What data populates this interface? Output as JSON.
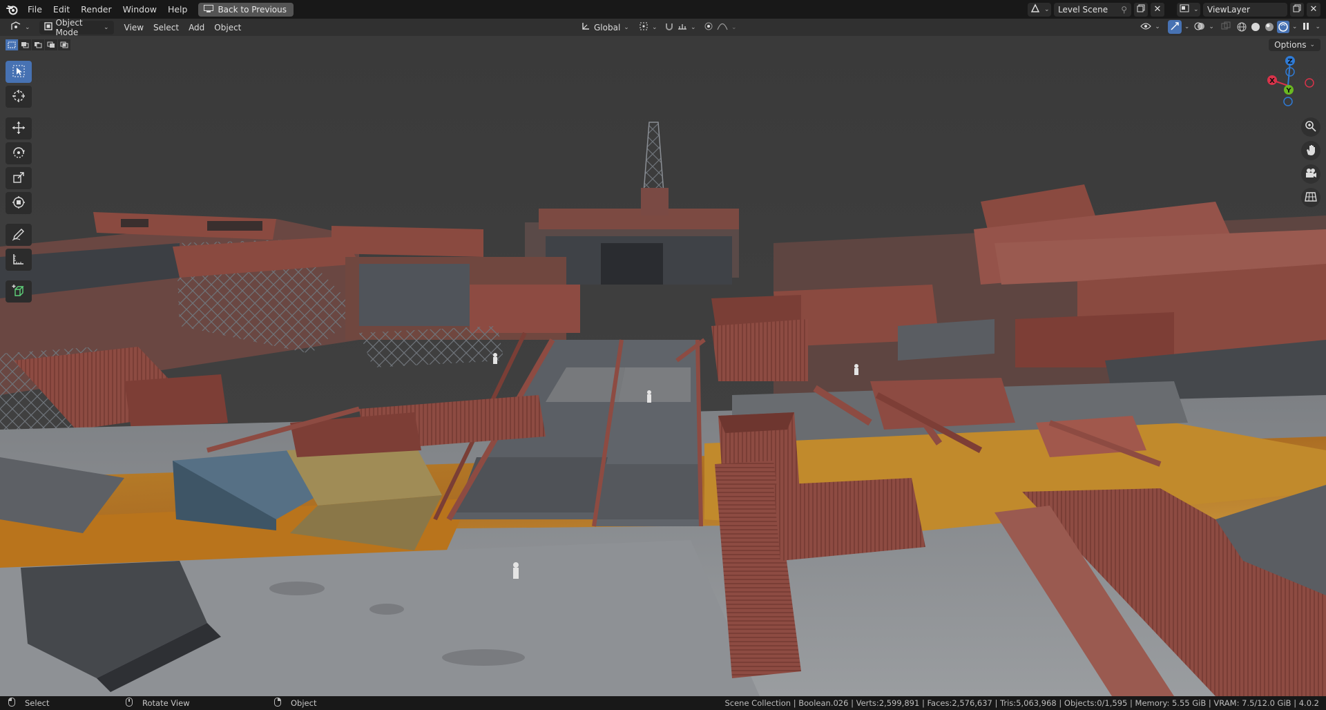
{
  "app": {
    "menus": [
      "File",
      "Edit",
      "Render",
      "Window",
      "Help"
    ],
    "back_label": "Back to Previous",
    "scene_name": "Level Scene",
    "view_layer": "ViewLayer"
  },
  "header": {
    "mode": "Object Mode",
    "menus": [
      "View",
      "Select",
      "Add",
      "Object"
    ],
    "transform_orientation": "Global"
  },
  "viewport": {
    "options_label": "Options",
    "gizmo_axes": {
      "x": "X",
      "y": "Y",
      "z": "Z"
    }
  },
  "toolbar": {
    "tools": [
      "select-box",
      "cursor",
      "move",
      "rotate",
      "scale",
      "transform",
      "annotate",
      "measure",
      "add-cube"
    ],
    "active": "select-box"
  },
  "statusbar": {
    "left_click": "Select",
    "middle_click": "Rotate View",
    "right_click": "Object",
    "stats": "Scene Collection | Boolean.026 | Verts:2,599,891 | Faces:2,576,637 | Tris:5,063,968 | Objects:0/1,595 | Memory: 5.55 GiB | VRAM: 7.5/12.0 GiB | 4.0.2"
  },
  "colors": {
    "accent": "#4772b3",
    "container_red": "#8a4a40",
    "concrete": "#8a8d90",
    "rust_floor": "#b8751e",
    "sky": "#3d3d3d"
  }
}
